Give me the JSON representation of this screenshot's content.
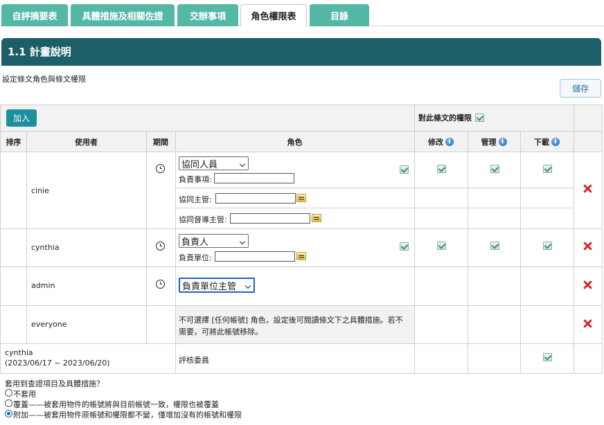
{
  "tabs": [
    {
      "label": "自評摘要表",
      "active": false
    },
    {
      "label": "具體措施及相關佐證",
      "active": false
    },
    {
      "label": "交辦事項",
      "active": false
    },
    {
      "label": "角色權限表",
      "active": true
    },
    {
      "label": "目錄",
      "active": false
    }
  ],
  "section_title": "1.1 計畫說明",
  "description": "設定條文角色與條文權限",
  "save_label": "儲存",
  "add_label": "加入",
  "perm_header": "對此條文的權限",
  "columns": {
    "order": "排序",
    "user": "使用者",
    "period": "期間",
    "role": "角色",
    "edit": "修改",
    "manage": "管理",
    "download": "下載"
  },
  "rows": [
    {
      "user": "cinie",
      "role_select": "協同人員",
      "fields": [
        "負責事項:",
        "協同主管:",
        "協同督導主管:"
      ]
    },
    {
      "user": "cynthia",
      "role_select": "負責人",
      "fields": [
        "負責單位:"
      ]
    },
    {
      "user": "admin",
      "role_select": "負責單位主管"
    },
    {
      "user": "everyone",
      "note": "不可選擇 [任何帳號] 角色，設定後可閱讀條文下之具體措施。若不需要，可將此帳號移除。"
    },
    {
      "user": "cynthia",
      "period": "(2023/06/17 ~ 2023/06/20)",
      "role": "評核委員"
    }
  ],
  "apply": {
    "question": "套用到查證項目及具體措施？",
    "options": [
      {
        "label": "不套用",
        "selected": false
      },
      {
        "label": "覆蓋——被套用物件的帳號將與目前帳號一致，權限也被覆蓋",
        "selected": false
      },
      {
        "label": "附加——被套用物件原帳號和權限都不變，僅增加沒有的帳號和權限",
        "selected": true
      }
    ]
  },
  "colors": {
    "tab": "#55b7a6",
    "section_bar": "#1c5f68",
    "add_button": "#1e8f9c",
    "delete": "#d8262b"
  }
}
